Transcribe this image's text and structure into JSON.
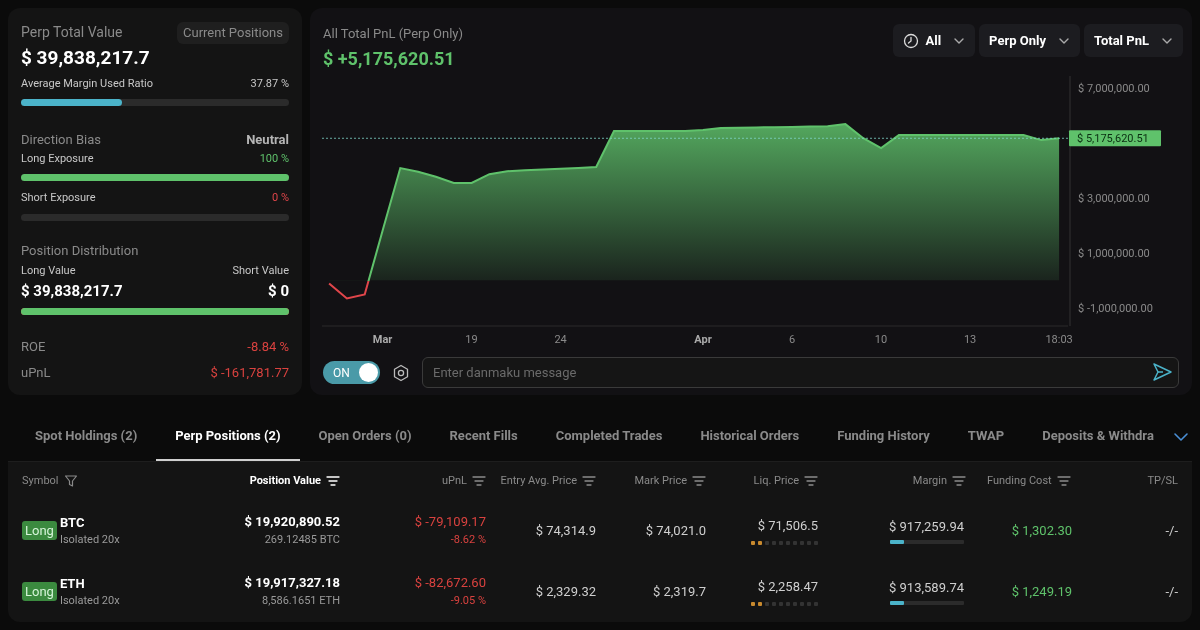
{
  "summary": {
    "title": "Perp Total Value",
    "view_button": "Current Positions",
    "total_value": "$ 39,838,217.7",
    "margin_ratio": {
      "label": "Average Margin Used Ratio",
      "reading": "37.87 %",
      "level": 0.3787
    },
    "direction": {
      "title": "Direction Bias",
      "value": "Neutral"
    },
    "exposures": [
      {
        "kind": "long",
        "label": "Long Exposure",
        "reading": "100 %",
        "level": 1.0
      },
      {
        "kind": "short",
        "label": "Short Exposure",
        "reading": "0 %",
        "level": 0.0
      }
    ],
    "distribution": {
      "title": "Position Distribution",
      "long_label": "Long Value",
      "short_label": "Short Value",
      "long_value": "$ 39,838,217.7",
      "short_value": "$ 0",
      "level": 1.0
    },
    "stats": [
      {
        "label": "ROE",
        "value": "-8.84 %"
      },
      {
        "label": "uPnL",
        "value": "$ -161,781.77"
      }
    ]
  },
  "pnl": {
    "title": "All Total PnL (Perp Only)",
    "value": "$ +5,175,620.51",
    "filters": [
      {
        "label": "All"
      },
      {
        "label": "Perp Only"
      },
      {
        "label": "Total PnL"
      }
    ],
    "chart_data": {
      "type": "area",
      "ylim": [
        -1650000,
        7440000
      ],
      "categories": [
        null,
        null,
        null,
        "Mar",
        null,
        null,
        null,
        null,
        "19",
        null,
        null,
        null,
        null,
        "24",
        null,
        null,
        null,
        null,
        null,
        null,
        null,
        "Apr",
        null,
        null,
        null,
        null,
        "6",
        null,
        null,
        null,
        null,
        "10",
        null,
        null,
        null,
        null,
        "13",
        null,
        null,
        null,
        null,
        "18:03"
      ],
      "yticks": [
        {
          "value": -1000000,
          "label": "$ -1,000,000.00"
        },
        {
          "value": 1000000,
          "label": "$ 1,000,000.00"
        },
        {
          "value": 3000000,
          "label": "$ 3,000,000.00"
        },
        {
          "value": 7000000,
          "label": "$ 7,000,000.00"
        }
      ],
      "series": [
        {
          "color": "#5fc26b",
          "values": [
            -100000,
            -650000,
            -500000,
            1800000,
            4090000,
            3960000,
            3780000,
            3550000,
            3550000,
            3870000,
            3980000,
            4010000,
            4040000,
            4070000,
            4100000,
            4130000,
            5440000,
            5440000,
            5440000,
            5440000,
            5440000,
            5480000,
            5550000,
            5560000,
            5570000,
            5580000,
            5590000,
            5600000,
            5610000,
            5690000,
            5180000,
            4820000,
            5290000,
            5290000,
            5290000,
            5290000,
            5290000,
            5290000,
            5290000,
            5290000,
            5110000,
            5180000
          ]
        }
      ],
      "ref_lines": [
        {
          "axis": "y",
          "value": 5175620.51,
          "label": "$ 5,175,620.51"
        }
      ]
    },
    "danmaku": {
      "toggle": {
        "label": "ON",
        "on": true
      },
      "placeholder": "Enter danmaku message"
    }
  },
  "tabs": [
    {
      "label": "Spot Holdings (2)",
      "selected": false
    },
    {
      "label": "Perp Positions (2)",
      "selected": true
    },
    {
      "label": "Open Orders (0)",
      "selected": false
    },
    {
      "label": "Recent Fills",
      "selected": false
    },
    {
      "label": "Completed Trades",
      "selected": false
    },
    {
      "label": "Historical Orders",
      "selected": false
    },
    {
      "label": "Funding History",
      "selected": false
    },
    {
      "label": "TWAP",
      "selected": false
    },
    {
      "label": "Deposits & Withdra",
      "selected": false
    }
  ],
  "table": {
    "columns": [
      {
        "label": "Symbol",
        "active": false
      },
      {
        "label": "Position Value",
        "active": true
      },
      {
        "label": "uPnL",
        "active": false
      },
      {
        "label": "Entry Avg. Price",
        "active": false
      },
      {
        "label": "Mark Price",
        "active": false
      },
      {
        "label": "Liq. Price",
        "active": false
      },
      {
        "label": "Margin",
        "active": false
      },
      {
        "label": "Funding Cost",
        "active": false
      },
      {
        "label": "TP/SL",
        "active": false
      }
    ],
    "rows": [
      {
        "side": "Long",
        "symbol": "BTC",
        "mode": "Isolated 20x",
        "position_value": "$ 19,920,890.52",
        "size": "269.12485 BTC",
        "upnl": "$ -79,109.17",
        "upnl_pct": "-8.62 %",
        "entry": "$ 74,314.9",
        "mark": "$ 74,021.0",
        "liq": {
          "price": "$ 71,506.5",
          "level": 0.2
        },
        "margin": {
          "value": "$ 917,259.94",
          "level": 0.19
        },
        "funding": "$ 1,302.30",
        "tpsl": "-/-"
      },
      {
        "side": "Long",
        "symbol": "ETH",
        "mode": "Isolated 20x",
        "position_value": "$ 19,917,327.18",
        "size": "8,586.1651 ETH",
        "upnl": "$ -82,672.60",
        "upnl_pct": "-9.05 %",
        "entry": "$ 2,329.32",
        "mark": "$ 2,319.7",
        "liq": {
          "price": "$ 2,258.47",
          "level": 0.2
        },
        "margin": {
          "value": "$ 913,589.74",
          "level": 0.19
        },
        "funding": "$ 1,249.19",
        "tpsl": "-/-"
      }
    ]
  }
}
